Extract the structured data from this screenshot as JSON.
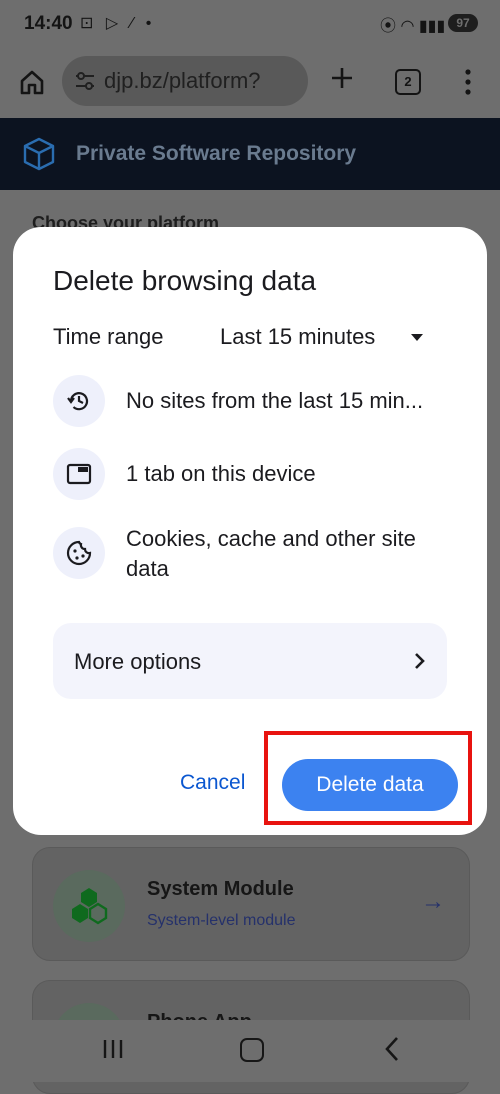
{
  "status_bar": {
    "time": "14:40",
    "battery": "97"
  },
  "browser": {
    "url": "djp.bz/platform?",
    "tab_count": "2"
  },
  "page": {
    "site_title": "Private Software Repository",
    "section_heading": "Choose your platform",
    "cards": [
      {
        "title": "System Module",
        "subtitle": "System-level module",
        "arrow": "→"
      },
      {
        "title": "Phone App"
      }
    ]
  },
  "dialog": {
    "title": "Delete browsing data",
    "time_range_label": "Time range",
    "time_range_value": "Last 15 minutes",
    "items": [
      {
        "icon": "history-icon",
        "text": "No sites from the last 15 min..."
      },
      {
        "icon": "tab-icon",
        "text": "1 tab on this device"
      },
      {
        "icon": "cookie-icon",
        "text": "Cookies, cache and other site data"
      }
    ],
    "more_options": "More options",
    "cancel": "Cancel",
    "delete": "Delete data"
  },
  "colors": {
    "accent": "#3c82f0",
    "highlight": "#e8130f"
  }
}
